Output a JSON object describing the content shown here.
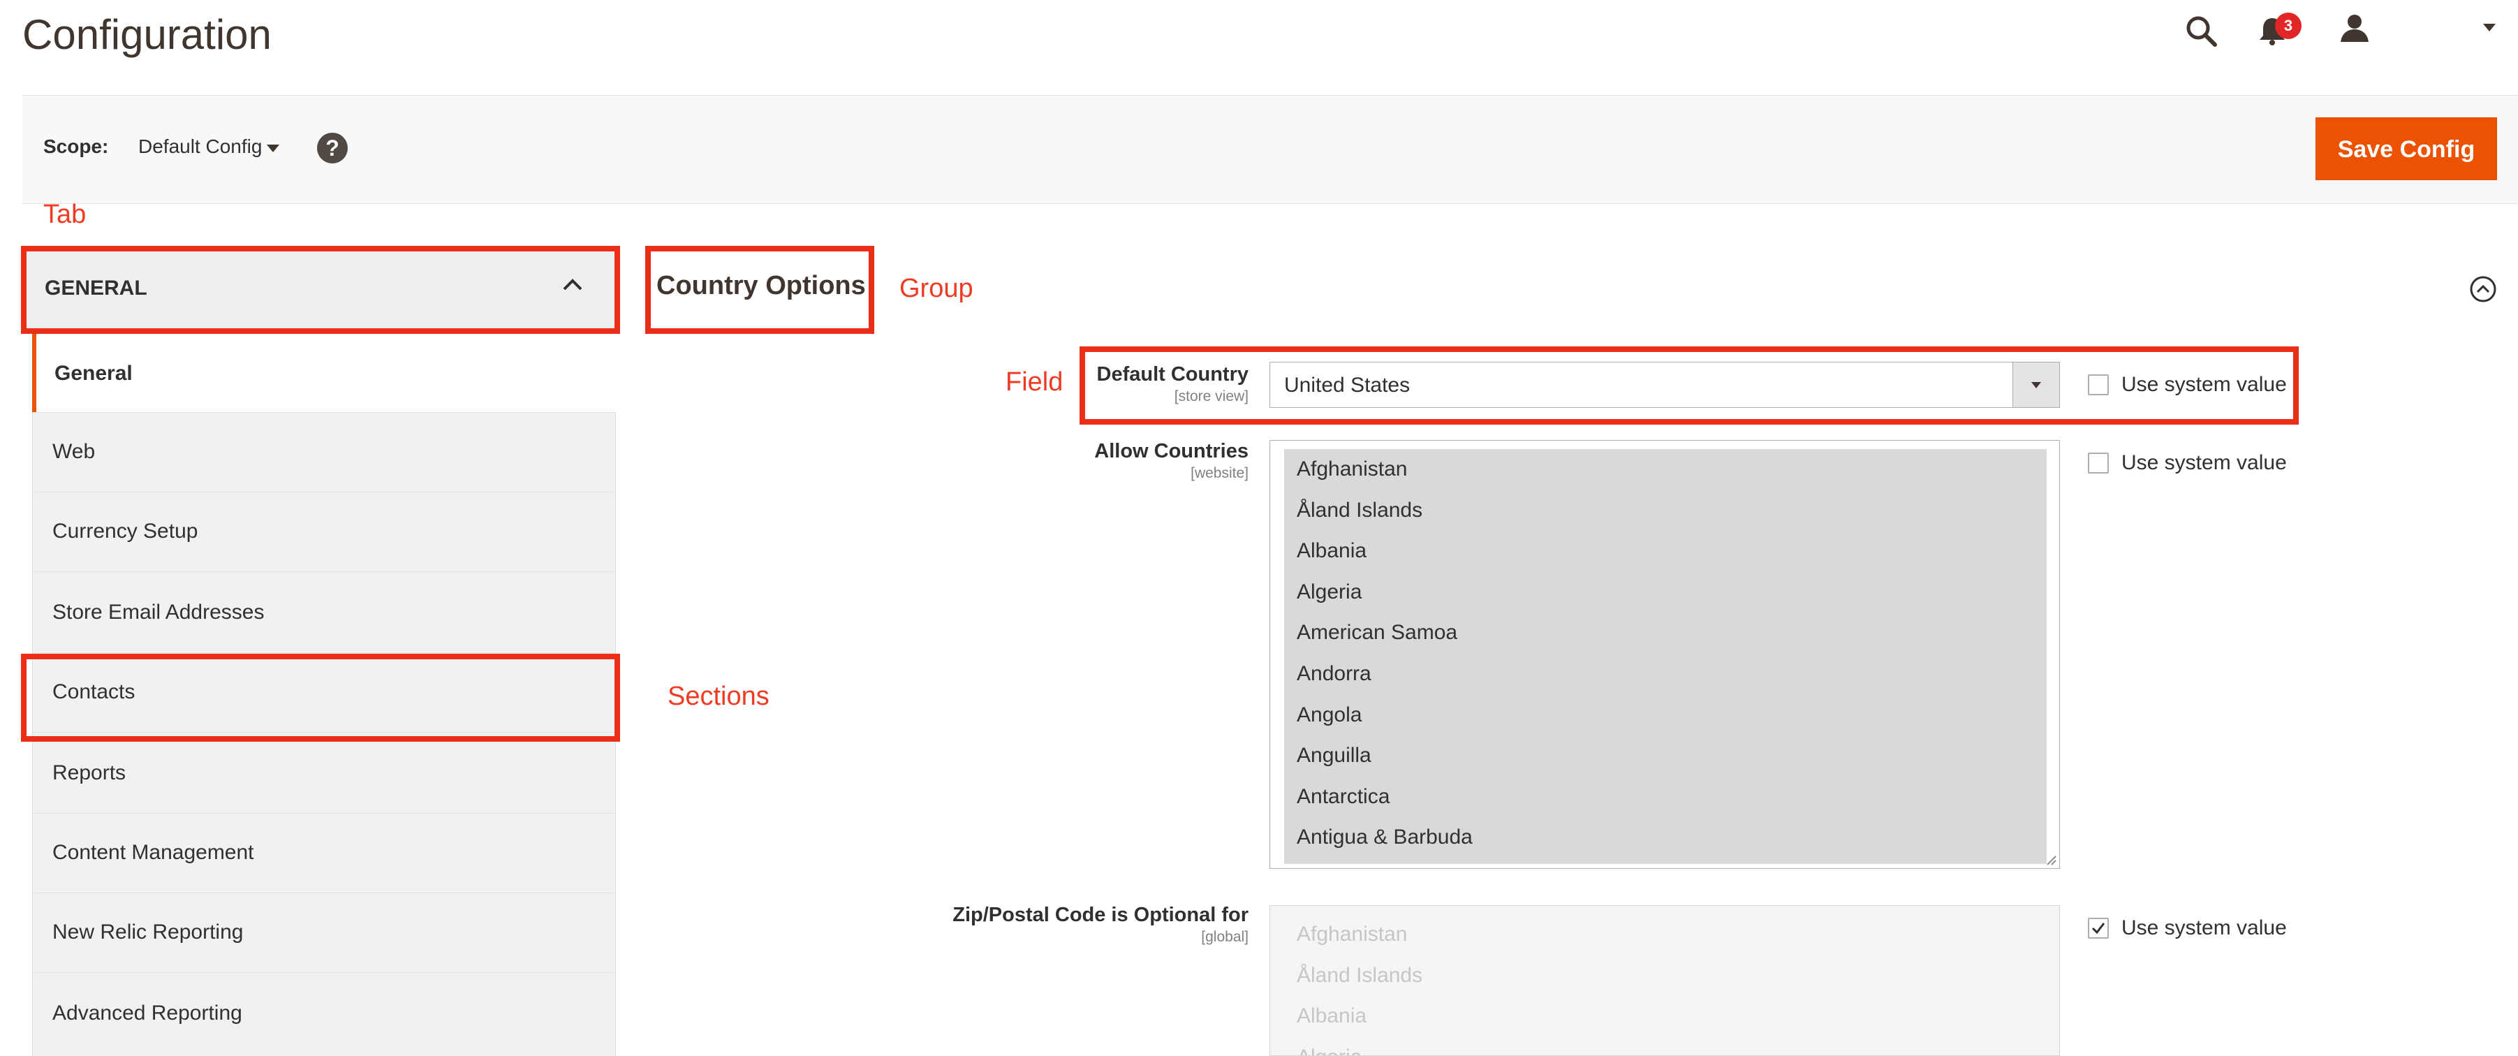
{
  "header": {
    "title": "Configuration",
    "notifications_count": "3",
    "icons": [
      "search-icon",
      "bell-icon",
      "user-icon",
      "caret-down-icon"
    ]
  },
  "scope": {
    "label": "Scope:",
    "value": "Default Config",
    "help": "?"
  },
  "actions": {
    "save_label": "Save Config"
  },
  "annotations": {
    "tab": "Tab",
    "group": "Group",
    "field": "Field",
    "sections": "Sections"
  },
  "sidebar": {
    "tab_label": "GENERAL",
    "items": [
      {
        "label": "General",
        "active": true
      },
      {
        "label": "Web"
      },
      {
        "label": "Currency Setup"
      },
      {
        "label": "Store Email Addresses"
      },
      {
        "label": "Contacts"
      },
      {
        "label": "Reports"
      },
      {
        "label": "Content Management"
      },
      {
        "label": "New Relic Reporting"
      },
      {
        "label": "Advanced Reporting"
      }
    ]
  },
  "group": {
    "title": "Country Options"
  },
  "fields": {
    "default_country": {
      "label": "Default Country",
      "scope": "[store view]",
      "value": "United States",
      "use_system_label": "Use system value",
      "use_system_checked": false
    },
    "allow_countries": {
      "label": "Allow Countries",
      "scope": "[website]",
      "options": [
        "Afghanistan",
        "Åland Islands",
        "Albania",
        "Algeria",
        "American Samoa",
        "Andorra",
        "Angola",
        "Anguilla",
        "Antarctica",
        "Antigua & Barbuda"
      ],
      "use_system_label": "Use system value",
      "use_system_checked": false
    },
    "zip_optional": {
      "label": "Zip/Postal Code is Optional for",
      "scope": "[global]",
      "options": [
        "Afghanistan",
        "Åland Islands",
        "Albania",
        "Algeria"
      ],
      "use_system_label": "Use system value",
      "use_system_checked": true
    }
  },
  "colors": {
    "accent": "#eb5202",
    "annotation": "#ea2e17",
    "badge": "#e22626"
  }
}
